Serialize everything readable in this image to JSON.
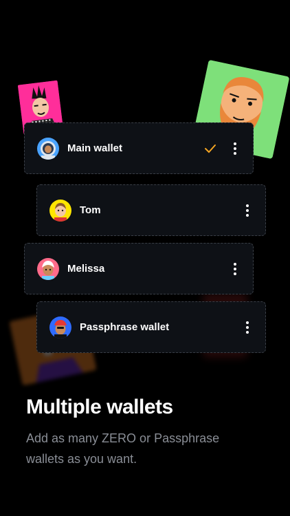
{
  "wallets": [
    {
      "name": "Main wallet",
      "selected": true,
      "avatar_icon": "astronaut-avatar-icon"
    },
    {
      "name": "Tom",
      "selected": false,
      "avatar_icon": "boy-avatar-icon"
    },
    {
      "name": "Melissa",
      "selected": false,
      "avatar_icon": "girl-avatar-icon"
    },
    {
      "name": "Passphrase wallet",
      "selected": false,
      "avatar_icon": "cap-avatar-icon"
    }
  ],
  "onboarding": {
    "title": "Multiple wallets",
    "subtitle": "Add as many ZERO or Passphrase wallets as you want."
  },
  "colors": {
    "background": "#000000",
    "card": "#0e1116",
    "check": "#f5a623",
    "subtitle": "#8a8e96",
    "punk_bg": "#ff2e9a",
    "beard_bg": "#7ee07a"
  }
}
